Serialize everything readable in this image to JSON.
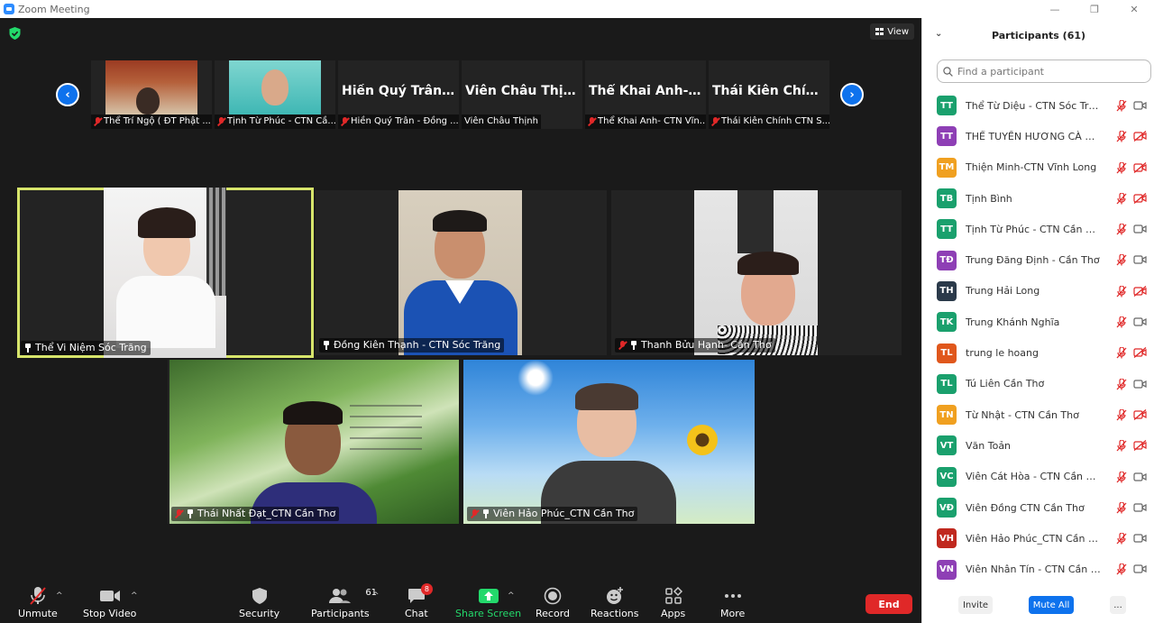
{
  "window": {
    "title": "Zoom Meeting",
    "controls": [
      "—",
      "❐",
      "✕"
    ]
  },
  "meeting": {
    "view_label": "View",
    "top_strip": [
      {
        "name": "Thể Trí Ngộ ( ĐT Phật ...",
        "big": ""
      },
      {
        "name": "Tịnh Từ Phúc - CTN Cầ...",
        "big": ""
      },
      {
        "name": "Hiền Quý Trân - Đồng ...",
        "big": "Hiền Quý Trân -..."
      },
      {
        "name": "Viên Châu Thịnh",
        "big": "Viên Châu Thịnh"
      },
      {
        "name": "Thể Khai Anh- CTN Vĩn...",
        "big": "Thể Khai Anh- C..."
      },
      {
        "name": "Thái Kiên Chính CTN S...",
        "big": "Thái Kiên Chính..."
      }
    ],
    "tiles": [
      {
        "name": "Thể Vi Niệm Sóc Trăng"
      },
      {
        "name": "Đồng Kiên Thạnh - CTN Sóc Trăng"
      },
      {
        "name": "Thanh Bửu Hạnh- Cần Thơ"
      },
      {
        "name": "Thái Nhất Đạt_CTN Cần Thơ"
      },
      {
        "name": "Viên Hảo Phúc_CTN Cần Thơ"
      }
    ]
  },
  "toolbar": {
    "unmute": "Unmute",
    "stop_video": "Stop Video",
    "security": "Security",
    "participants": "Participants",
    "participants_count": "61",
    "chat": "Chat",
    "chat_badge": "8",
    "share_screen": "Share Screen",
    "record": "Record",
    "reactions": "Reactions",
    "apps": "Apps",
    "more": "More",
    "end": "End"
  },
  "panel": {
    "title": "Participants (61)",
    "search_placeholder": "Find a participant",
    "participants": [
      {
        "initials": "TT",
        "name": "Thể Từ Diệu - CTN Sóc Trăng",
        "color": "#1aa06d",
        "cam_off": false
      },
      {
        "initials": "TT",
        "name": "THỂ TUYỀN HƯƠNG CÀ MAU",
        "color": "#8e3fb5",
        "cam_off": true
      },
      {
        "initials": "TM",
        "name": "Thiện Minh-CTN Vĩnh Long",
        "color": "#f0a020",
        "cam_off": true
      },
      {
        "initials": "TB",
        "name": "Tịnh Bình",
        "color": "#1aa06d",
        "cam_off": true
      },
      {
        "initials": "TT",
        "name": "Tịnh Từ Phúc - CTN Cần Thơ",
        "color": "#1aa06d",
        "cam_off": false
      },
      {
        "initials": "TĐ",
        "name": "Trung Đăng Định - Cần Thơ",
        "color": "#8e3fb5",
        "cam_off": false
      },
      {
        "initials": "TH",
        "name": "Trung Hải Long",
        "color": "#2b3a4a",
        "cam_off": true
      },
      {
        "initials": "TK",
        "name": "Trung Khánh Nghĩa",
        "color": "#1aa06d",
        "cam_off": false
      },
      {
        "initials": "TL",
        "name": "trung le hoang",
        "color": "#e0571c",
        "cam_off": true
      },
      {
        "initials": "TL",
        "name": "Tú Liên Cần Thơ",
        "color": "#1aa06d",
        "cam_off": false
      },
      {
        "initials": "TN",
        "name": "Từ Nhật - CTN Cần Thơ",
        "color": "#f0a020",
        "cam_off": true
      },
      {
        "initials": "VT",
        "name": "Văn Toản",
        "color": "#1aa06d",
        "cam_off": true
      },
      {
        "initials": "VC",
        "name": "Viên Cát Hòa - CTN Cần Thơ",
        "color": "#1aa06d",
        "cam_off": false
      },
      {
        "initials": "VĐ",
        "name": "Viên Đồng CTN Cần Thơ",
        "color": "#1aa06d",
        "cam_off": false
      },
      {
        "initials": "VH",
        "name": "Viên Hảo Phúc_CTN Cần Thơ",
        "color": "#c0281e",
        "cam_off": false
      },
      {
        "initials": "VN",
        "name": "Viên Nhân Tín - CTN Cần Thơ",
        "color": "#8e3fb5",
        "cam_off": false
      }
    ],
    "invite": "Invite",
    "mute_all": "Mute All",
    "more": "..."
  }
}
